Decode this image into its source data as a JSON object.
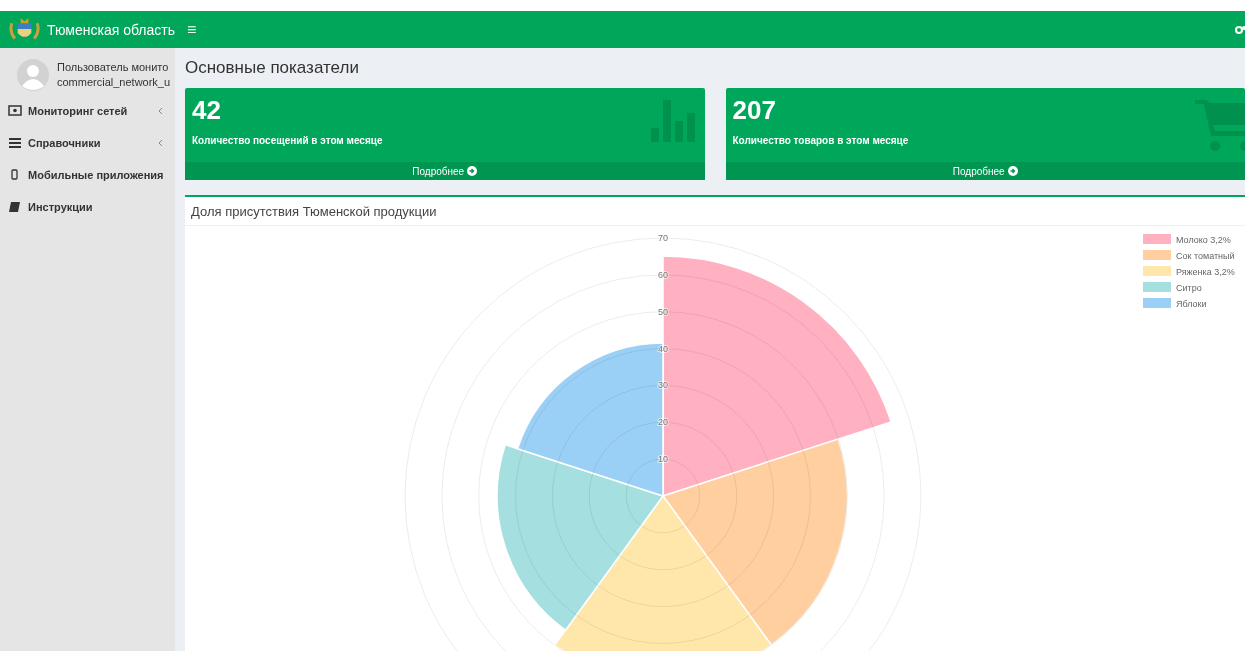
{
  "header": {
    "brand": "Тюменская область",
    "menu_toggle": "≡"
  },
  "user": {
    "name": "Пользователь монито",
    "login": "commercial_network_u"
  },
  "sidebar": {
    "items": [
      {
        "label": "Мониторинг сетей",
        "kind": "monitor",
        "expandable": true
      },
      {
        "label": "Справочники",
        "kind": "list",
        "expandable": true
      },
      {
        "label": "Мобильные приложения",
        "kind": "mobile",
        "expandable": false
      },
      {
        "label": "Инструкции",
        "kind": "book",
        "expandable": false
      }
    ]
  },
  "page_title": "Основные показатели",
  "cards": [
    {
      "value": "42",
      "label": "Количество посещений в этом месяце",
      "kind": "chart",
      "more": "Подробнее"
    },
    {
      "value": "207",
      "label": "Количество товаров в этом месяце",
      "kind": "cart",
      "more": "Подробнее"
    }
  ],
  "chart_panel": {
    "title": "Доля присутствия Тюменской продукции",
    "radial_ticks": [
      "70",
      "60",
      "50",
      "40",
      "30",
      "20",
      "10"
    ],
    "legend": [
      {
        "label": "Молоко 3,2%",
        "color": "#ffb1c1"
      },
      {
        "label": "Сок томатный",
        "color": "#ffcf9f"
      },
      {
        "label": "Ряженка 3,2%",
        "color": "#ffe6aa"
      },
      {
        "label": "Ситро",
        "color": "#a5dfdf"
      },
      {
        "label": "Яблоки",
        "color": "#9ad0f5"
      }
    ]
  }
}
